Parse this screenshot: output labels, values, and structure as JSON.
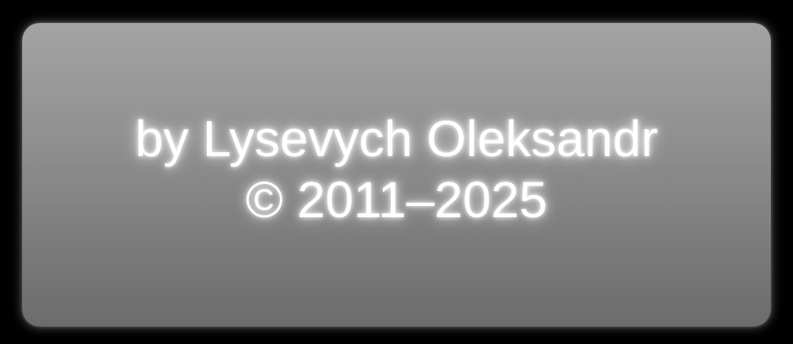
{
  "credits": {
    "author_line": "by Lysevych Oleksandr",
    "copyright_line": "© 2011–2025"
  },
  "colors": {
    "background": "#000000",
    "panel_top": "#a3a3a3",
    "panel_bottom": "#6c6c6c",
    "text": "#ffffff"
  }
}
